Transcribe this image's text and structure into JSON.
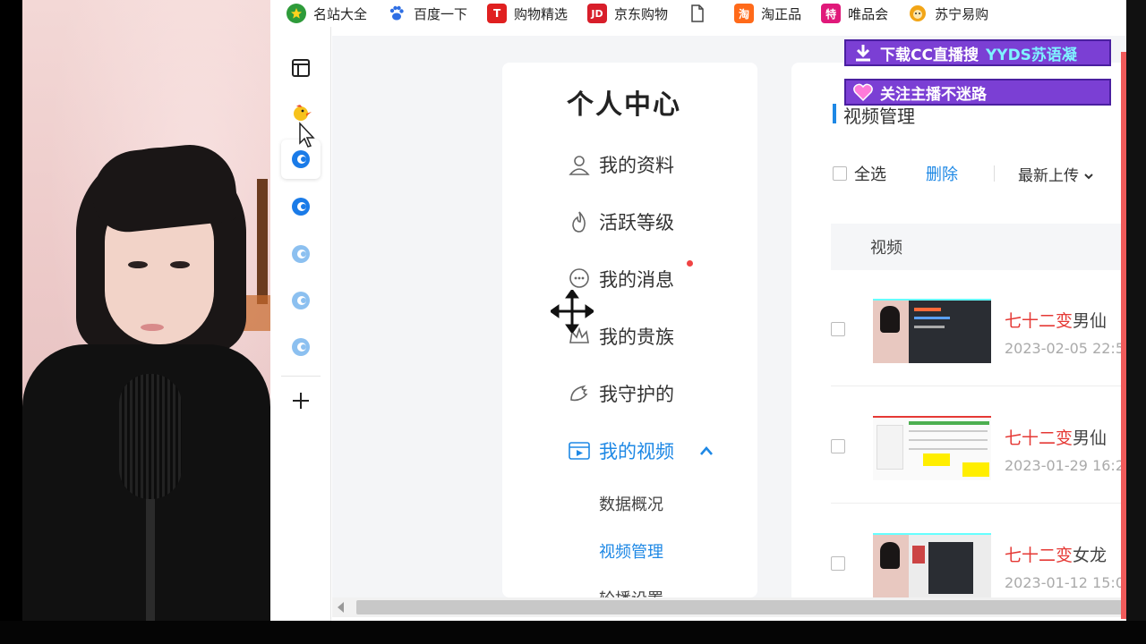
{
  "bookmarks": [
    {
      "label": "名站大全",
      "icon": "star-globe-icon",
      "color": "#2e9b3a"
    },
    {
      "label": "百度一下",
      "icon": "baidu-paw-icon",
      "color": "#2f6fe4"
    },
    {
      "label": "购物精选",
      "icon": "tmall-t-icon",
      "icon_text": "T",
      "color": "#e02020"
    },
    {
      "label": "京东购物",
      "icon": "jd-icon",
      "icon_text": "JD",
      "color": "#d81e2a"
    },
    {
      "label": "",
      "icon": "document-icon",
      "color": "#555555"
    },
    {
      "label": "淘正品",
      "icon": "taobao-icon",
      "icon_text": "淘",
      "color": "#ff6a1a"
    },
    {
      "label": "唯品会",
      "icon": "vip-te-icon",
      "icon_text": "特",
      "color": "#e0197a"
    },
    {
      "label": "苏宁易购",
      "icon": "suning-lion-icon",
      "color": "#f2a516"
    }
  ],
  "personal_center": {
    "title": "个人中心",
    "menu": [
      {
        "label": "我的资料",
        "icon": "user-icon"
      },
      {
        "label": "活跃等级",
        "icon": "flame-icon"
      },
      {
        "label": "我的消息",
        "icon": "message-icon"
      },
      {
        "label": "我的贵族",
        "icon": "crown-icon"
      },
      {
        "label": "我守护的",
        "icon": "wing-icon"
      },
      {
        "label": "我的视频",
        "icon": "video-icon"
      }
    ],
    "submenu": [
      "数据概况",
      "视频管理",
      "轮播设置"
    ]
  },
  "video_manager": {
    "title": "视频管理",
    "select_all": "全选",
    "delete": "删除",
    "sort": "最新上传",
    "column_header": "视频",
    "videos": [
      {
        "title_red": "七十二变",
        "title_dark": "男仙",
        "date": "2023-02-05 22:5"
      },
      {
        "title_red": "七十二变",
        "title_dark": "男仙",
        "date": "2023-01-29 16:2"
      },
      {
        "title_red": "七十二变",
        "title_dark": "女龙",
        "date": "2023-01-12 15:0"
      }
    ]
  },
  "overlay": {
    "banner1_text": "下载CC直播搜",
    "banner1_highlight": "YYDS苏语凝",
    "banner2_text": "关注主播不迷路"
  },
  "colors": {
    "accent": "#1e88e5",
    "red": "#e53935",
    "banner": "#7b3fd4"
  }
}
